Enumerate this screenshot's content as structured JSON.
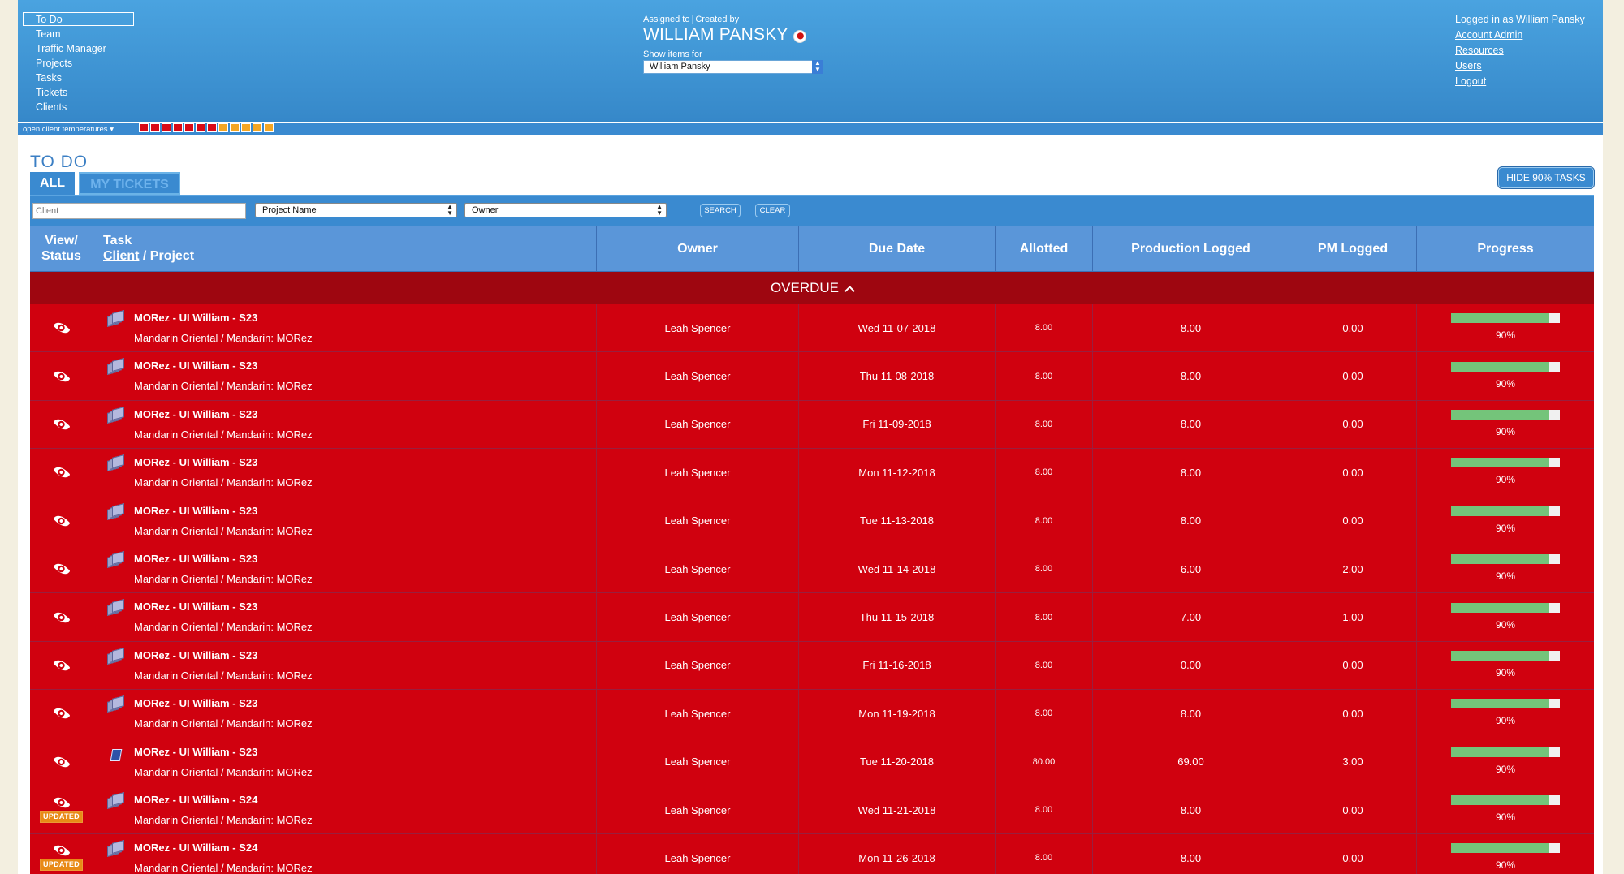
{
  "nav": [
    "To Do",
    "Team",
    "Traffic Manager",
    "Projects",
    "Tasks",
    "Tickets",
    "Clients"
  ],
  "header": {
    "assigned_to": "Assigned to",
    "created_by": "Created by",
    "user_name": "WILLIAM PANSKY",
    "show_items_for": "Show items for",
    "owner_select_value": "William Pansky"
  },
  "account": {
    "logged_in": "Logged in as William Pansky",
    "links": [
      "Account Admin",
      "Resources",
      "Users",
      "Logout"
    ]
  },
  "temp_bar": {
    "toggle_label": "open client temperatures",
    "swatches": [
      "#d90a16",
      "#d90a16",
      "#d90a16",
      "#d90a16",
      "#d90a16",
      "#d90a16",
      "#d90a16",
      "#f5a623",
      "#f5a623",
      "#f5a623",
      "#f5a623",
      "#f5a623"
    ]
  },
  "page_title": "TO DO",
  "tabs": {
    "all": "ALL",
    "my_tickets": "MY TICKETS"
  },
  "hide_button": "HIDE 90% TASKS",
  "filters": {
    "client_placeholder": "Client",
    "project_select": "Project Name",
    "owner_select": "Owner",
    "search_button": "SEARCH",
    "clear_button": "CLEAR"
  },
  "columns": {
    "view_status_1": "View/",
    "view_status_2": "Status",
    "task": "Task",
    "client": "Client",
    "project_sep": " / Project",
    "owner": "Owner",
    "due_date": "Due Date",
    "allotted": "Allotted",
    "production_logged": "Production Logged",
    "pm_logged": "PM Logged",
    "progress": "Progress"
  },
  "group_label": "OVERDUE",
  "rows": [
    {
      "icon": "stack",
      "badge": "",
      "title": "MORez - UI William - S23",
      "sub": "Mandarin Oriental / Mandarin: MORez",
      "owner": "Leah Spencer",
      "due": "Wed 11-07-2018",
      "allotted": "8.00",
      "production": "8.00",
      "pm": "0.00",
      "progress_text": "90%",
      "progress": 0.9
    },
    {
      "icon": "stack",
      "badge": "",
      "title": "MORez - UI William - S23",
      "sub": "Mandarin Oriental / Mandarin: MORez",
      "owner": "Leah Spencer",
      "due": "Thu 11-08-2018",
      "allotted": "8.00",
      "production": "8.00",
      "pm": "0.00",
      "progress_text": "90%",
      "progress": 0.9
    },
    {
      "icon": "stack",
      "badge": "",
      "title": "MORez - UI William - S23",
      "sub": "Mandarin Oriental / Mandarin: MORez",
      "owner": "Leah Spencer",
      "due": "Fri 11-09-2018",
      "allotted": "8.00",
      "production": "8.00",
      "pm": "0.00",
      "progress_text": "90%",
      "progress": 0.9
    },
    {
      "icon": "stack",
      "badge": "",
      "title": "MORez - UI William - S23",
      "sub": "Mandarin Oriental / Mandarin: MORez",
      "owner": "Leah Spencer",
      "due": "Mon 11-12-2018",
      "allotted": "8.00",
      "production": "8.00",
      "pm": "0.00",
      "progress_text": "90%",
      "progress": 0.9
    },
    {
      "icon": "stack",
      "badge": "",
      "title": "MORez - UI William - S23",
      "sub": "Mandarin Oriental / Mandarin: MORez",
      "owner": "Leah Spencer",
      "due": "Tue 11-13-2018",
      "allotted": "8.00",
      "production": "8.00",
      "pm": "0.00",
      "progress_text": "90%",
      "progress": 0.9
    },
    {
      "icon": "stack",
      "badge": "",
      "title": "MORez - UI William - S23",
      "sub": "Mandarin Oriental / Mandarin: MORez",
      "owner": "Leah Spencer",
      "due": "Wed 11-14-2018",
      "allotted": "8.00",
      "production": "6.00",
      "pm": "2.00",
      "progress_text": "90%",
      "progress": 0.9
    },
    {
      "icon": "stack",
      "badge": "",
      "title": "MORez - UI William - S23",
      "sub": "Mandarin Oriental / Mandarin: MORez",
      "owner": "Leah Spencer",
      "due": "Thu 11-15-2018",
      "allotted": "8.00",
      "production": "7.00",
      "pm": "1.00",
      "progress_text": "90%",
      "progress": 0.9
    },
    {
      "icon": "stack",
      "badge": "",
      "title": "MORez - UI William - S23",
      "sub": "Mandarin Oriental / Mandarin: MORez",
      "owner": "Leah Spencer",
      "due": "Fri 11-16-2018",
      "allotted": "8.00",
      "production": "0.00",
      "pm": "0.00",
      "progress_text": "90%",
      "progress": 0.9
    },
    {
      "icon": "stack",
      "badge": "",
      "title": "MORez - UI William - S23",
      "sub": "Mandarin Oriental / Mandarin: MORez",
      "owner": "Leah Spencer",
      "due": "Mon 11-19-2018",
      "allotted": "8.00",
      "production": "8.00",
      "pm": "0.00",
      "progress_text": "90%",
      "progress": 0.9
    },
    {
      "icon": "book",
      "badge": "",
      "title": "MORez - UI William - S23",
      "sub": "Mandarin Oriental / Mandarin: MORez",
      "owner": "Leah Spencer",
      "due": "Tue 11-20-2018",
      "allotted": "80.00",
      "production": "69.00",
      "pm": "3.00",
      "progress_text": "90%",
      "progress": 0.9
    },
    {
      "icon": "stack",
      "badge": "UPDATED",
      "title": "MORez - UI William - S24",
      "sub": "Mandarin Oriental / Mandarin: MORez",
      "owner": "Leah Spencer",
      "due": "Wed 11-21-2018",
      "allotted": "8.00",
      "production": "8.00",
      "pm": "0.00",
      "progress_text": "90%",
      "progress": 0.9
    },
    {
      "icon": "stack",
      "badge": "UPDATED",
      "title": "MORez - UI William - S24",
      "sub": "Mandarin Oriental / Mandarin: MORez",
      "owner": "Leah Spencer",
      "due": "Mon 11-26-2018",
      "allotted": "8.00",
      "production": "8.00",
      "pm": "0.00",
      "progress_text": "90%",
      "progress": 0.9
    }
  ]
}
